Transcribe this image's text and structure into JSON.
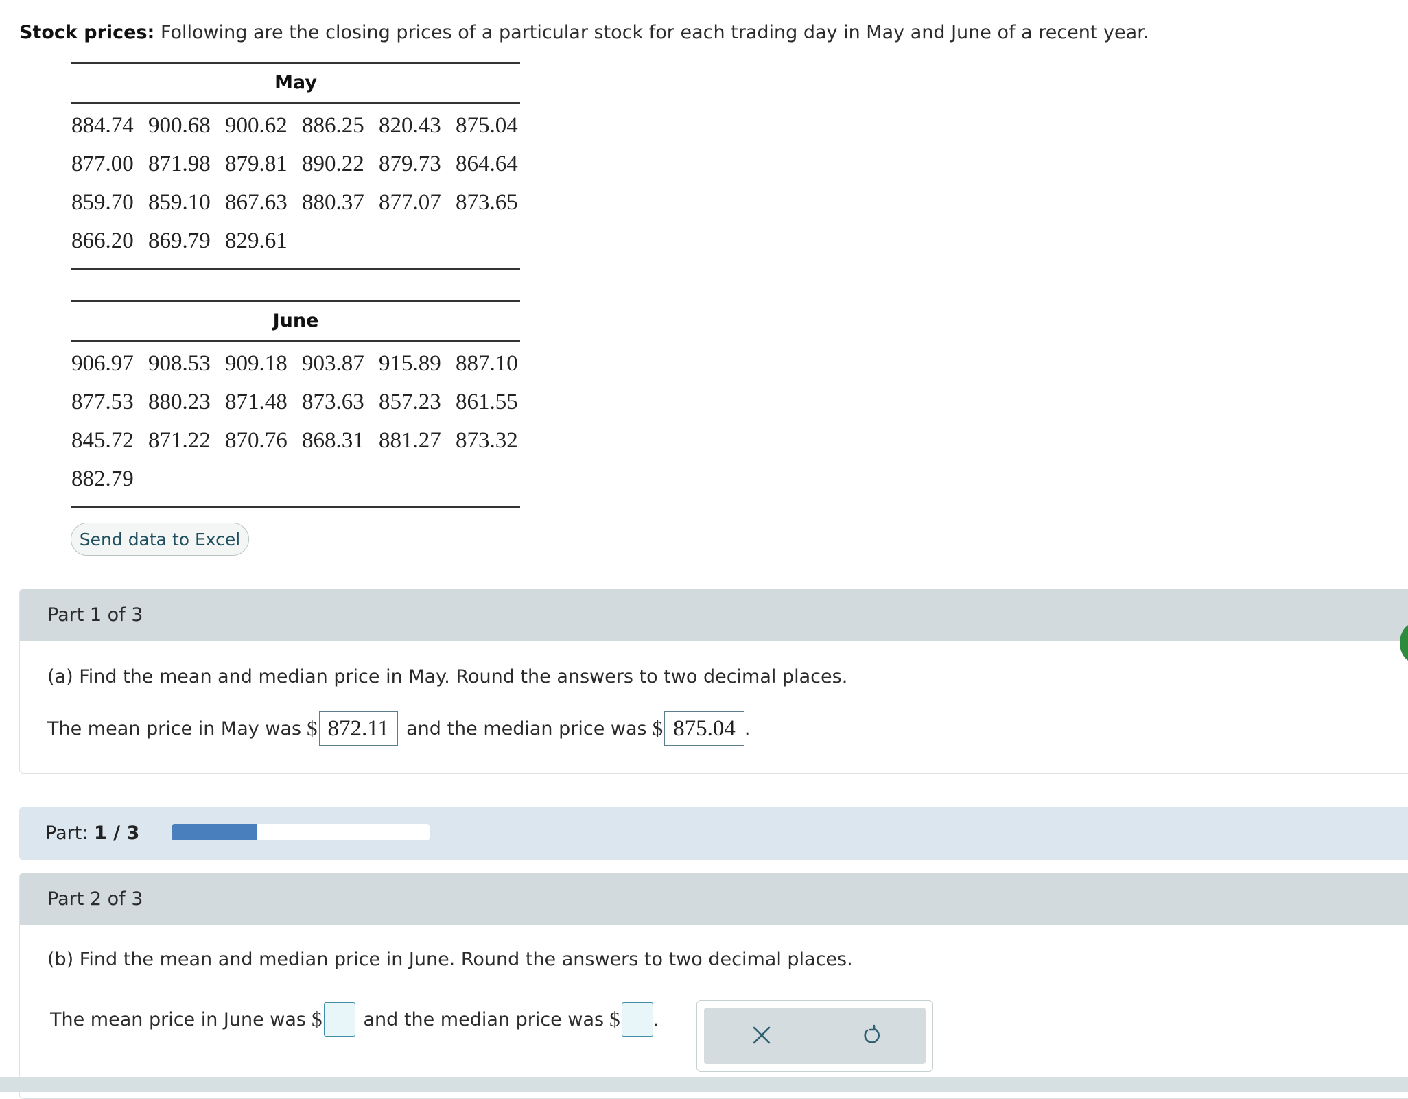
{
  "intro": {
    "bold": "Stock prices:",
    "text": " Following are the closing prices of a particular stock for each trading day in May and June of a recent year."
  },
  "may": {
    "title": "May",
    "rows": [
      [
        "884.74",
        "900.68",
        "900.62",
        "886.25",
        "820.43",
        "875.04"
      ],
      [
        "877.00",
        "871.98",
        "879.81",
        "890.22",
        "879.73",
        "864.64"
      ],
      [
        "859.70",
        "859.10",
        "867.63",
        "880.37",
        "877.07",
        "873.65"
      ],
      [
        "866.20",
        "869.79",
        "829.61"
      ]
    ]
  },
  "june": {
    "title": "June",
    "rows": [
      [
        "906.97",
        "908.53",
        "909.18",
        "903.87",
        "915.89",
        "887.10"
      ],
      [
        "877.53",
        "880.23",
        "871.48",
        "873.63",
        "857.23",
        "861.55"
      ],
      [
        "845.72",
        "871.22",
        "870.76",
        "868.31",
        "881.27",
        "873.32"
      ],
      [
        "882.79"
      ]
    ]
  },
  "excel_button": "Send data to Excel",
  "part1": {
    "header": "Part 1 of 3",
    "question": "(a) Find the mean and median price in May. Round the answers to two decimal places.",
    "mean_prefix": "The mean price in May was",
    "dollar": "$",
    "mean_value": "872.11",
    "median_prefix": "and the median price was",
    "median_value": "875.04",
    "period": "."
  },
  "progress": {
    "label": "Part:",
    "value": "1 / 3",
    "fraction": 0.3333
  },
  "part2": {
    "header": "Part 2 of 3",
    "question": "(b) Find the mean and median price in June. Round the answers to two decimal places.",
    "mean_prefix": "The mean price in June was",
    "dollar": "$",
    "median_prefix": "and the median price was",
    "period": "."
  },
  "icons": {
    "clear": "close-x-icon",
    "undo": "undo-arrow-icon"
  },
  "colors": {
    "panel_header": "#d2dadd",
    "progress_fill": "#4a7fbd",
    "input_border": "#3f8fa5"
  }
}
